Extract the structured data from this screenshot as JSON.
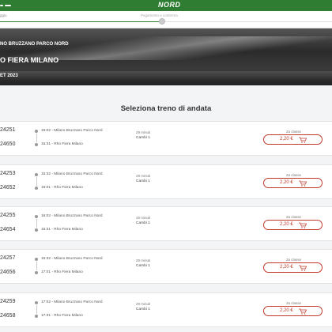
{
  "header": {
    "logo": "NORD",
    "step_left": "ggio",
    "step_mid": "Pagamento e conferma"
  },
  "hero": {
    "from": "NO BRUZZANO PARCO NORD",
    "to": "O FIERA MILANO",
    "date": "ET 2023"
  },
  "main": {
    "title": "Seleziona treno di andata"
  },
  "trains": [
    {
      "train_out": "24251",
      "train_in": "24650",
      "dep": "15:02 - Milano Bruzzano Parco Nord",
      "arr": "15:31 - Rho Fiera Milano",
      "duration": "29 minuti",
      "changes": "Cambi 1",
      "class": "2a classe",
      "price": "2,20 €"
    },
    {
      "train_out": "24253",
      "train_in": "24652",
      "dep": "15:32 - Milano Bruzzano Parco Nord",
      "arr": "16:01 - Rho Fiera Milano",
      "duration": "29 minuti",
      "changes": "Cambi 1",
      "class": "2a classe",
      "price": "2,20 €"
    },
    {
      "train_out": "24255",
      "train_in": "24654",
      "dep": "16:02 - Milano Bruzzano Parco Nord",
      "arr": "16:31 - Rho Fiera Milano",
      "duration": "29 minuti",
      "changes": "Cambi 1",
      "class": "2a classe",
      "price": "2,20 €"
    },
    {
      "train_out": "24257",
      "train_in": "24656",
      "dep": "16:32 - Milano Bruzzano Parco Nord",
      "arr": "17:01 - Rho Fiera Milano",
      "duration": "29 minuti",
      "changes": "Cambi 1",
      "class": "2a classe",
      "price": "2,20 €"
    },
    {
      "train_out": "24259",
      "train_in": "24658",
      "dep": "17:02 - Milano Bruzzano Parco Nord",
      "arr": "17:31 - Rho Fiera Milano",
      "duration": "29 minuti",
      "changes": "Cambi 1",
      "class": "2a classe",
      "price": "2,20 €"
    }
  ],
  "icons": {
    "cart": "cart-icon",
    "menu": "menu-icon"
  },
  "colors": {
    "brand": "#2e7d32",
    "price": "#c0392b"
  }
}
